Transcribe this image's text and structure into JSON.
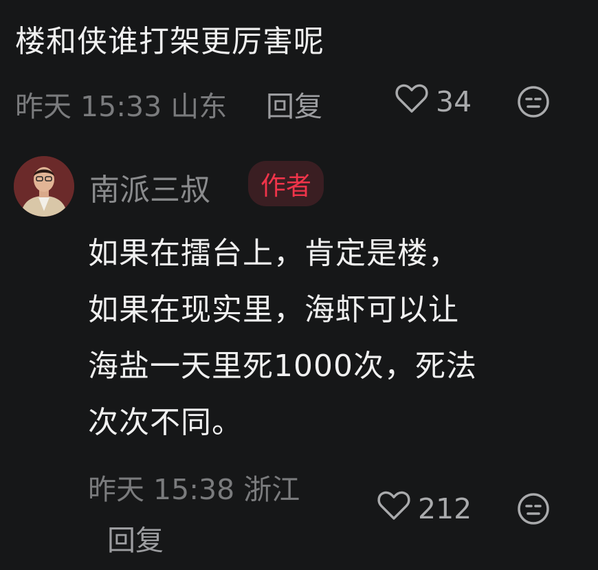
{
  "comment": {
    "text": "楼和侠谁打架更厉害呢",
    "meta": "昨天 15:33 山东",
    "reply_label": "回复",
    "like_count": "34"
  },
  "reply": {
    "author": "南派三叔",
    "badge": "作者",
    "lines": [
      "如果在擂台上，肯定是楼，",
      "如果在现实里，海虾可以让",
      "海盐一天里死1000次，死法",
      "次次不同。"
    ],
    "meta": "昨天 15:38 浙江",
    "reply_label": "回复",
    "like_count": "212"
  },
  "colors": {
    "background": "#161718",
    "badge_text": "#f0344a",
    "badge_bg": "#3a1e22"
  },
  "icons": [
    "heart-icon",
    "emoji-icon"
  ]
}
